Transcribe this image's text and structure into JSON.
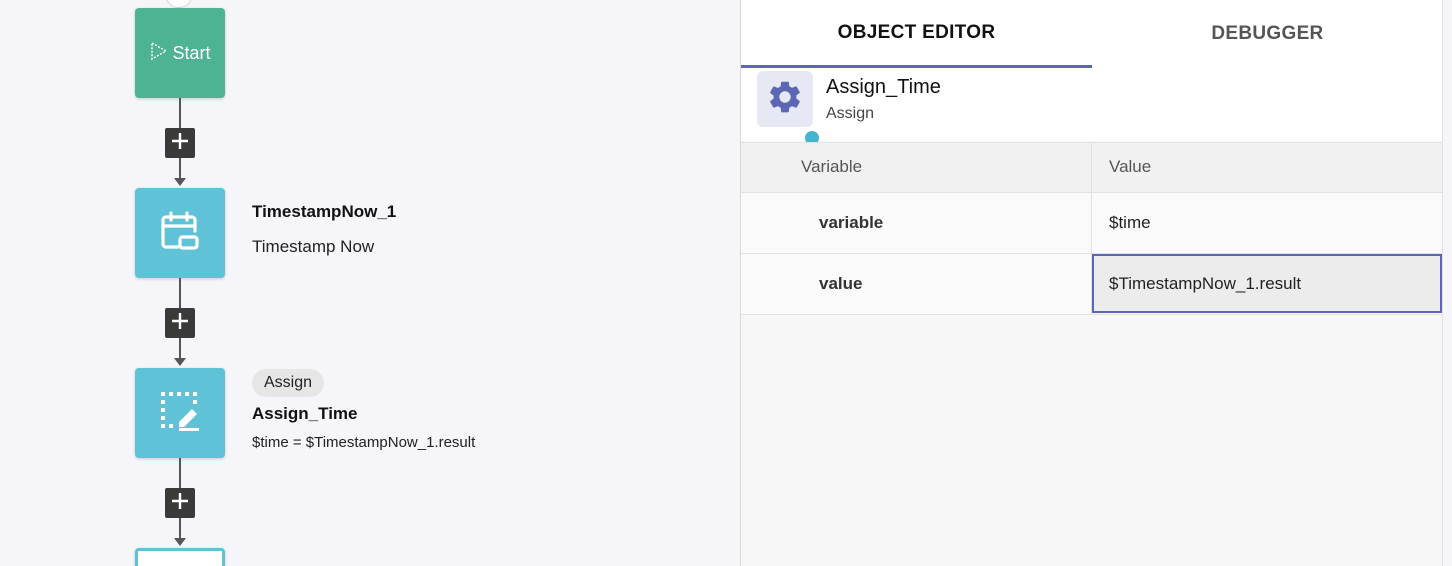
{
  "canvas": {
    "start": {
      "label": "Start",
      "icon": "play-icon",
      "top_badge_icon": "corner-bracket-icon"
    },
    "nodes": [
      {
        "title": "TimestampNow_1",
        "subtitle": "Timestamp Now",
        "icon": "calendar-icon"
      },
      {
        "chip": "Assign",
        "title": "Assign_Time",
        "expression": "$time = $TimestampNow_1.result",
        "icon": "edit-select-icon"
      }
    ],
    "add_step_icon": "plus-icon",
    "colors": {
      "start": "#4eb393",
      "step": "#5fc2d6",
      "connector": "#555555",
      "add_button": "#3a3a3a"
    }
  },
  "panel": {
    "tabs": [
      {
        "label": "OBJECT EDITOR",
        "active": true
      },
      {
        "label": "DEBUGGER",
        "active": false
      }
    ],
    "object": {
      "name": "Assign_Time",
      "type": "Assign",
      "icon": "gear-icon"
    },
    "table": {
      "headers": [
        "Variable",
        "Value"
      ],
      "rows": [
        {
          "key": "variable",
          "value": "$time"
        },
        {
          "key": "value",
          "value": "$TimestampNow_1.result",
          "selected": true
        }
      ]
    },
    "colors": {
      "accent": "#5b66b5",
      "icon_bg": "#e6e8f4",
      "dot": "#46b3cf"
    }
  }
}
